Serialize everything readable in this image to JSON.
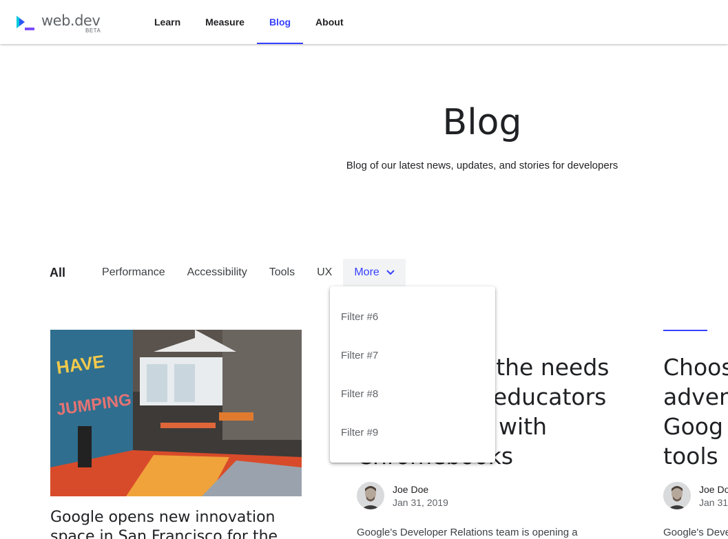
{
  "header": {
    "logo_text": "web.dev",
    "logo_badge": "BETA",
    "nav": [
      {
        "label": "Learn"
      },
      {
        "label": "Measure"
      },
      {
        "label": "Blog"
      },
      {
        "label": "About"
      }
    ],
    "active_nav": "Blog"
  },
  "hero": {
    "title": "Blog",
    "subtitle": "Blog of our latest news, updates, and stories for developers"
  },
  "filters": {
    "items": [
      "All",
      "Performance",
      "Accessibility",
      "Tools",
      "UX"
    ],
    "more_label": "More",
    "dropdown": [
      "Filter #6",
      "Filter #7",
      "Filter #8",
      "Filter #9"
    ]
  },
  "cards": [
    {
      "title": "Google opens new innovation space in San Francisco for the"
    },
    {
      "title_lines": [
        "Adapting to the needs",
        "of learners, educators",
        "and schools with",
        "Chromebooks"
      ],
      "author": "Joe Doe",
      "date": "Jan 31, 2019",
      "desc": "Google's Developer Relations team is opening a"
    },
    {
      "title_lines": [
        "Choos",
        "adven",
        "Goog",
        "tools"
      ],
      "author": "Joe Do",
      "date": "Jan 31",
      "desc": "Google's Deve"
    }
  ],
  "colors": {
    "accent": "#3740ff",
    "text": "#202124",
    "muted": "#5f6368"
  }
}
